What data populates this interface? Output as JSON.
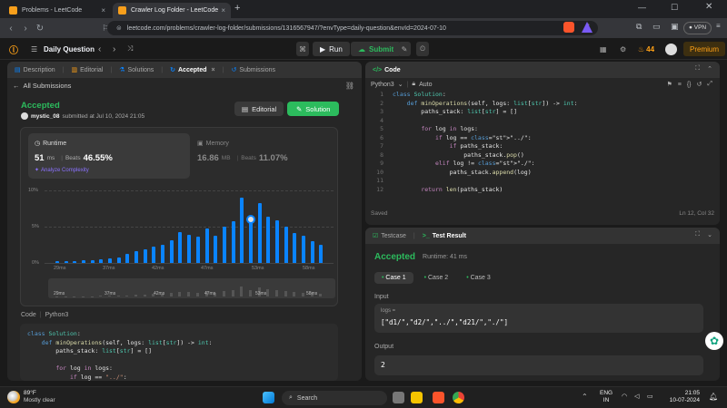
{
  "browser": {
    "tabs": [
      {
        "title": "Problems - LeetCode",
        "active": false
      },
      {
        "title": "Crawler Log Folder - LeetCode",
        "active": true
      }
    ],
    "new_tab": "+",
    "url": "leetcode.com/problems/crawler-log-folder/submissions/1316567947/?envType=daily-question&envId=2024-07-10",
    "vpn_label": "VPN",
    "window_controls": [
      "minimize-icon",
      "maximize-icon",
      "close-icon"
    ]
  },
  "header": {
    "daily_label": "Daily Question",
    "run_label": "Run",
    "submit_label": "Submit",
    "streak": "44",
    "premium_label": "Premium"
  },
  "left_panel": {
    "tabs": [
      "Description",
      "Editorial",
      "Solutions",
      "Accepted",
      "Submissions"
    ],
    "all_submissions": "All Submissions",
    "status": "Accepted",
    "user": "mystic_08",
    "submitted_text": "submitted at Jul 10, 2024 21:05",
    "editorial_btn": "Editorial",
    "solution_btn": "Solution",
    "runtime": {
      "label": "Runtime",
      "value": "51",
      "unit": "ms",
      "beats_label": "Beats",
      "beats": "46.55%",
      "analyze": "Analyze Complexity"
    },
    "memory": {
      "label": "Memory",
      "value": "16.86",
      "unit": "MB",
      "beats_label": "Beats",
      "beats": "11.07%"
    },
    "code_label": "Code",
    "language": "Python3",
    "code_lines": [
      "class Solution:",
      "    def minOperations(self, logs: list[str]) -> int:",
      "        paths_stack: list[str] = []",
      "",
      "        for log in logs:",
      "            if log == \"../\":"
    ]
  },
  "chart_data": {
    "type": "bar",
    "y_ticks": [
      "10%",
      "5%",
      "0%"
    ],
    "x_ticks": [
      "29ms",
      "37ms",
      "42ms",
      "47ms",
      "53ms",
      "58ms"
    ],
    "values": [
      0.2,
      0.3,
      0.3,
      0.4,
      0.4,
      0.5,
      0.6,
      0.8,
      1.2,
      1.6,
      1.9,
      2.2,
      2.5,
      3.1,
      4.3,
      3.9,
      3.6,
      4.8,
      3.7,
      5.0,
      5.8,
      9.0,
      6.0,
      8.3,
      6.4,
      5.9,
      5.0,
      4.1,
      3.7,
      3.0,
      2.5
    ],
    "highlight_index": 22,
    "ylim": [
      0,
      10
    ]
  },
  "right_top": {
    "title": "Code",
    "language": "Python3",
    "auto_label": "Auto",
    "status": "Saved",
    "cursor": "Ln 12, Col 32",
    "code": [
      {
        "n": "1",
        "t": "class Solution:"
      },
      {
        "n": "2",
        "t": "    def minOperations(self, logs: list[str]) -> int:"
      },
      {
        "n": "3",
        "t": "        paths_stack: list[str] = []"
      },
      {
        "n": "4",
        "t": ""
      },
      {
        "n": "5",
        "t": "        for log in logs:"
      },
      {
        "n": "6",
        "t": "            if log == \"../\":"
      },
      {
        "n": "7",
        "t": "                if paths_stack:"
      },
      {
        "n": "8",
        "t": "                    paths_stack.pop()"
      },
      {
        "n": "9",
        "t": "            elif log != \"./\":"
      },
      {
        "n": "10",
        "t": "                paths_stack.append(log)"
      },
      {
        "n": "11",
        "t": ""
      },
      {
        "n": "12",
        "t": "        return len(paths_stack)"
      }
    ]
  },
  "right_bottom": {
    "tab_testcase": "Testcase",
    "tab_result": "Test Result",
    "status": "Accepted",
    "runtime": "Runtime: 41 ms",
    "cases": [
      "Case 1",
      "Case 2",
      "Case 3"
    ],
    "input_label": "Input",
    "param_name": "logs =",
    "param_value": "[\"d1/\",\"d2/\",\"../\",\"d21/\",\"./\"]",
    "output_label": "Output",
    "output_value": "2"
  },
  "taskbar": {
    "weather_temp": "89°F",
    "weather_desc": "Mostly clear",
    "search_placeholder": "Search",
    "lang": "ENG",
    "region": "IN",
    "time": "21:05",
    "date": "10-07-2024"
  }
}
